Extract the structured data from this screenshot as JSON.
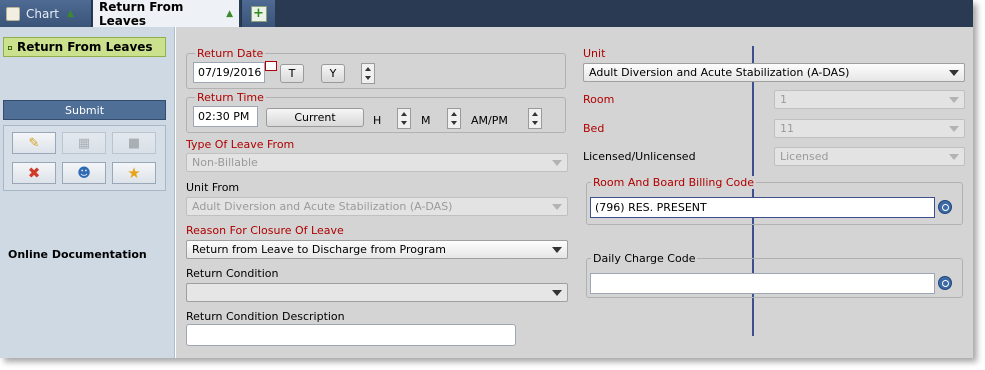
{
  "tabs": {
    "chart": "Chart",
    "active": "Return From Leaves"
  },
  "sidebar": {
    "item": "Return From Leaves",
    "submit": "Submit",
    "online_doc": "Online Documentation"
  },
  "form": {
    "return_date_legend": "Return Date",
    "return_date_value": "07/19/2016",
    "btn_today": "T",
    "btn_yesterday": "Y",
    "return_time_legend": "Return Time",
    "return_time_value": "02:30 PM",
    "btn_current": "Current",
    "lbl_h": "H",
    "lbl_m": "M",
    "lbl_ampm": "AM/PM",
    "type_of_leave_label": "Type Of Leave From",
    "type_of_leave_value": "Non-Billable",
    "unit_from_label": "Unit From",
    "unit_from_value": "Adult Diversion and Acute Stabilization (A-DAS)",
    "reason_label": "Reason For Closure Of Leave",
    "reason_value": "Return from Leave to Discharge from Program",
    "return_condition_label": "Return Condition",
    "return_condition_value": "",
    "return_condition_desc_label": "Return Condition Description",
    "return_condition_desc_value": "",
    "unit_label": "Unit",
    "unit_value": "Adult Diversion and Acute Stabilization (A-DAS)",
    "room_label": "Room",
    "room_value": "1",
    "bed_label": "Bed",
    "bed_value": "11",
    "licensed_label": "Licensed/Unlicensed",
    "licensed_value": "Licensed",
    "room_board_legend": "Room And Board Billing Code",
    "room_board_value": "(796) RES. PRESENT",
    "daily_charge_legend": "Daily Charge Code",
    "daily_charge_value": ""
  }
}
